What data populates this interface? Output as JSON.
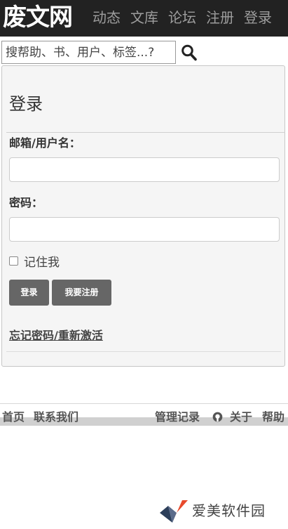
{
  "brand": "废文网",
  "nav": [
    "动态",
    "文库",
    "论坛",
    "注册",
    "登录"
  ],
  "search": {
    "placeholder": "搜帮助、书、用户、标签...?",
    "value": ""
  },
  "login": {
    "title": "登录",
    "email_label": "邮箱/用户名：",
    "password_label": "密码：",
    "remember_label": "记住我",
    "login_button": "登录",
    "register_button": "我要注册",
    "forgot_link": "忘记密码/重新激活"
  },
  "footer": {
    "home": "首页",
    "contact": "联系我们",
    "admin_log": "管理记录",
    "about": "关于",
    "help": "帮助"
  },
  "watermark": {
    "text": "爱美软件园"
  },
  "colors": {
    "navbar": "#222222",
    "nav_text": "#9d9d9d",
    "button": "#666666",
    "panel": "#f5f5f5"
  }
}
